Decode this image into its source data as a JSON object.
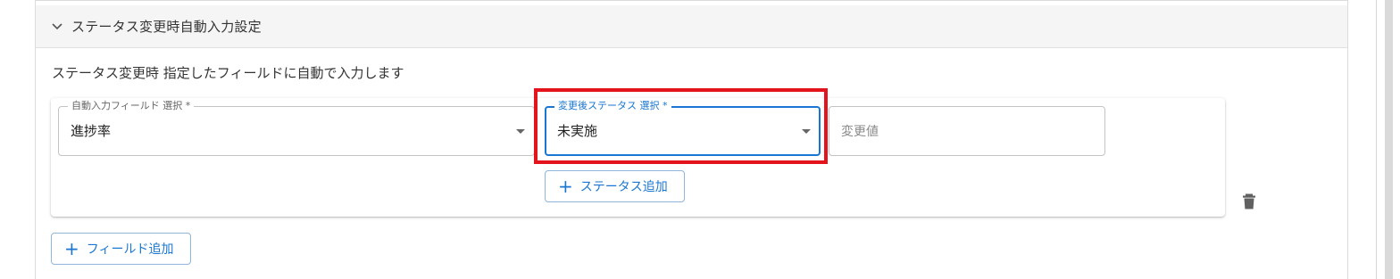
{
  "section": {
    "title": "ステータス変更時自動入力設定",
    "description": "ステータス変更時 指定したフィールドに自動で入力します"
  },
  "field_select": {
    "label": "自動入力フィールド 選択 *",
    "value": "進捗率"
  },
  "status_select": {
    "label": "変更後ステータス 選択 *",
    "value": "未実施"
  },
  "change_value": {
    "placeholder": "変更値"
  },
  "buttons": {
    "add_status": "ステータス追加",
    "add_field": "フィールド追加",
    "plus": "+"
  },
  "icons": {
    "expand": "chevron-down-icon",
    "dropdown": "caret-down-icon",
    "delete": "trash-icon"
  },
  "colors": {
    "accent": "#1976d2",
    "highlight": "#e3141b",
    "header_bg": "#f5f5f5"
  }
}
